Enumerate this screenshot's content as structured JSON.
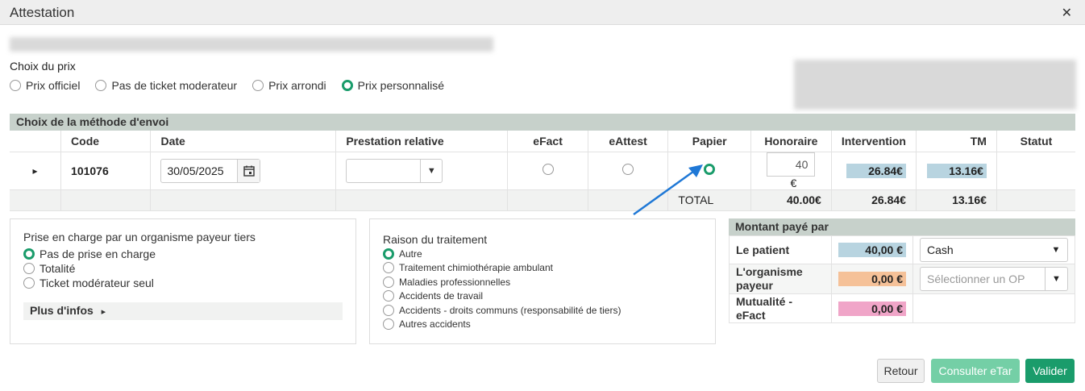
{
  "window": {
    "title": "Attestation",
    "close_glyph": "✕"
  },
  "price": {
    "label": "Choix du prix",
    "options": [
      "Prix officiel",
      "Pas de ticket moderateur",
      "Prix arrondi",
      "Prix personnalisé"
    ],
    "selected": 3
  },
  "grid": {
    "section_label": "Choix de la méthode d'envoi",
    "headers": [
      "Code",
      "Date",
      "Prestation relative",
      "eFact",
      "eAttest",
      "Papier",
      "Honoraire",
      "Intervention",
      "TM",
      "Statut"
    ],
    "row": {
      "expand_glyph": "▸",
      "code": "101076",
      "date": "30/05/2025",
      "prestation": "",
      "honoraire": "40",
      "currency": "€",
      "intervention": "26.84€",
      "tm": "13.16€",
      "statut": ""
    },
    "total": {
      "label": "TOTAL",
      "honoraire": "40.00€",
      "intervention": "26.84€",
      "tm": "13.16€"
    }
  },
  "tiers": {
    "title": "Prise en charge par un organisme payeur tiers",
    "options": [
      "Pas de prise en charge",
      "Totalité",
      "Ticket modérateur seul"
    ],
    "selected": 0,
    "more_info": "Plus d'infos",
    "more_info_glyph": "▸"
  },
  "raison": {
    "title": "Raison du traitement",
    "options": [
      "Autre",
      "Traitement chimiothérapie ambulant",
      "Maladies professionnelles",
      "Accidents de travail",
      "Accidents - droits communs (responsabilité de tiers)",
      "Autres accidents"
    ],
    "selected": 0
  },
  "montant": {
    "title": "Montant payé par",
    "patient_label": "Le patient",
    "patient_amount": "40,00 €",
    "patient_method": "Cash",
    "organisme_label": "L'organisme payeur",
    "organisme_amount": "0,00 €",
    "organisme_placeholder": "Sélectionner un OP",
    "mutualite_label": "Mutualité - eFact",
    "mutualite_amount": "0,00 €"
  },
  "buttons": {
    "retour": "Retour",
    "consulter": "Consulter eTar",
    "valider": "Valider"
  },
  "colors": {
    "accent": "#1a9c6b",
    "accent_light": "#74cfa6",
    "section_bar": "#c7d1cb",
    "patient_tag": "#b8d4e0",
    "organisme_tag": "#f5c198",
    "mutualite_tag": "#f0a5c8",
    "arrow": "#1f78d6"
  },
  "icons": {
    "calendar": "calendar-icon",
    "dropdown": "chevron-down-icon",
    "close": "close-icon",
    "arrow": "annotation-arrow-icon"
  }
}
